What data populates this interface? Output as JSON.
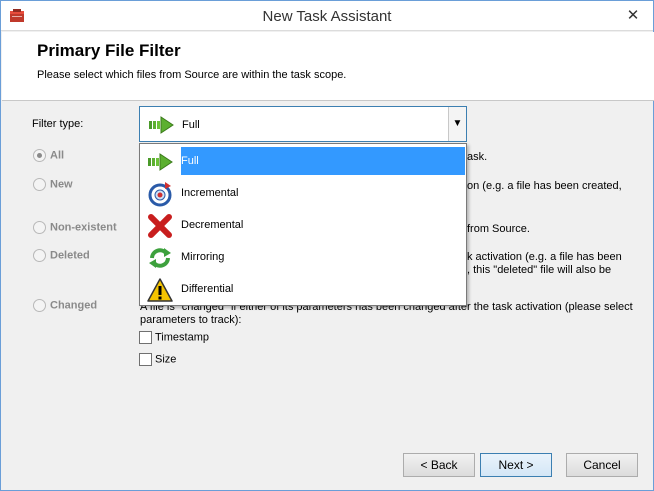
{
  "window": {
    "title": "New Task Assistant",
    "close_glyph": "✕"
  },
  "header": {
    "title": "Primary File Filter",
    "subtitle": "Please select which files from Source are within the task scope."
  },
  "filter": {
    "label": "Filter type:",
    "selected_value": "Full",
    "options": [
      {
        "label": "Full",
        "icon": "green-arrow-icon",
        "selected": true
      },
      {
        "label": "Incremental",
        "icon": "incremental-target-icon",
        "selected": false
      },
      {
        "label": "Decremental",
        "icon": "red-x-icon",
        "selected": false
      },
      {
        "label": "Mirroring",
        "icon": "green-cycle-icon",
        "selected": false
      },
      {
        "label": "Differential",
        "icon": "warning-triangle-icon",
        "selected": false
      }
    ]
  },
  "radios": [
    {
      "label": "All",
      "checked": true,
      "desc": "ask."
    },
    {
      "label": "New",
      "checked": false,
      "desc": "on (e.g. a file has been created,"
    },
    {
      "label": "Non-existent",
      "checked": false,
      "desc": "from Source."
    },
    {
      "label": "Deleted",
      "checked": false,
      "desc_line1": "k activation (e.g. a file has been",
      "desc_line2": ", this \"deleted\" file will also be"
    },
    {
      "label": "Changed",
      "checked": false,
      "desc_line1": "A file is \"changed\" if either of its parameters has been changed after the task activation (please select",
      "desc_line2": "parameters to track):"
    }
  ],
  "checkboxes": [
    {
      "label": "Timestamp",
      "checked": false
    },
    {
      "label": "Size",
      "checked": false
    }
  ],
  "buttons": {
    "back": "< Back",
    "next": "Next >",
    "cancel": "Cancel"
  },
  "colors": {
    "accent": "#3399ff",
    "border_focus": "#3c7fb1"
  }
}
